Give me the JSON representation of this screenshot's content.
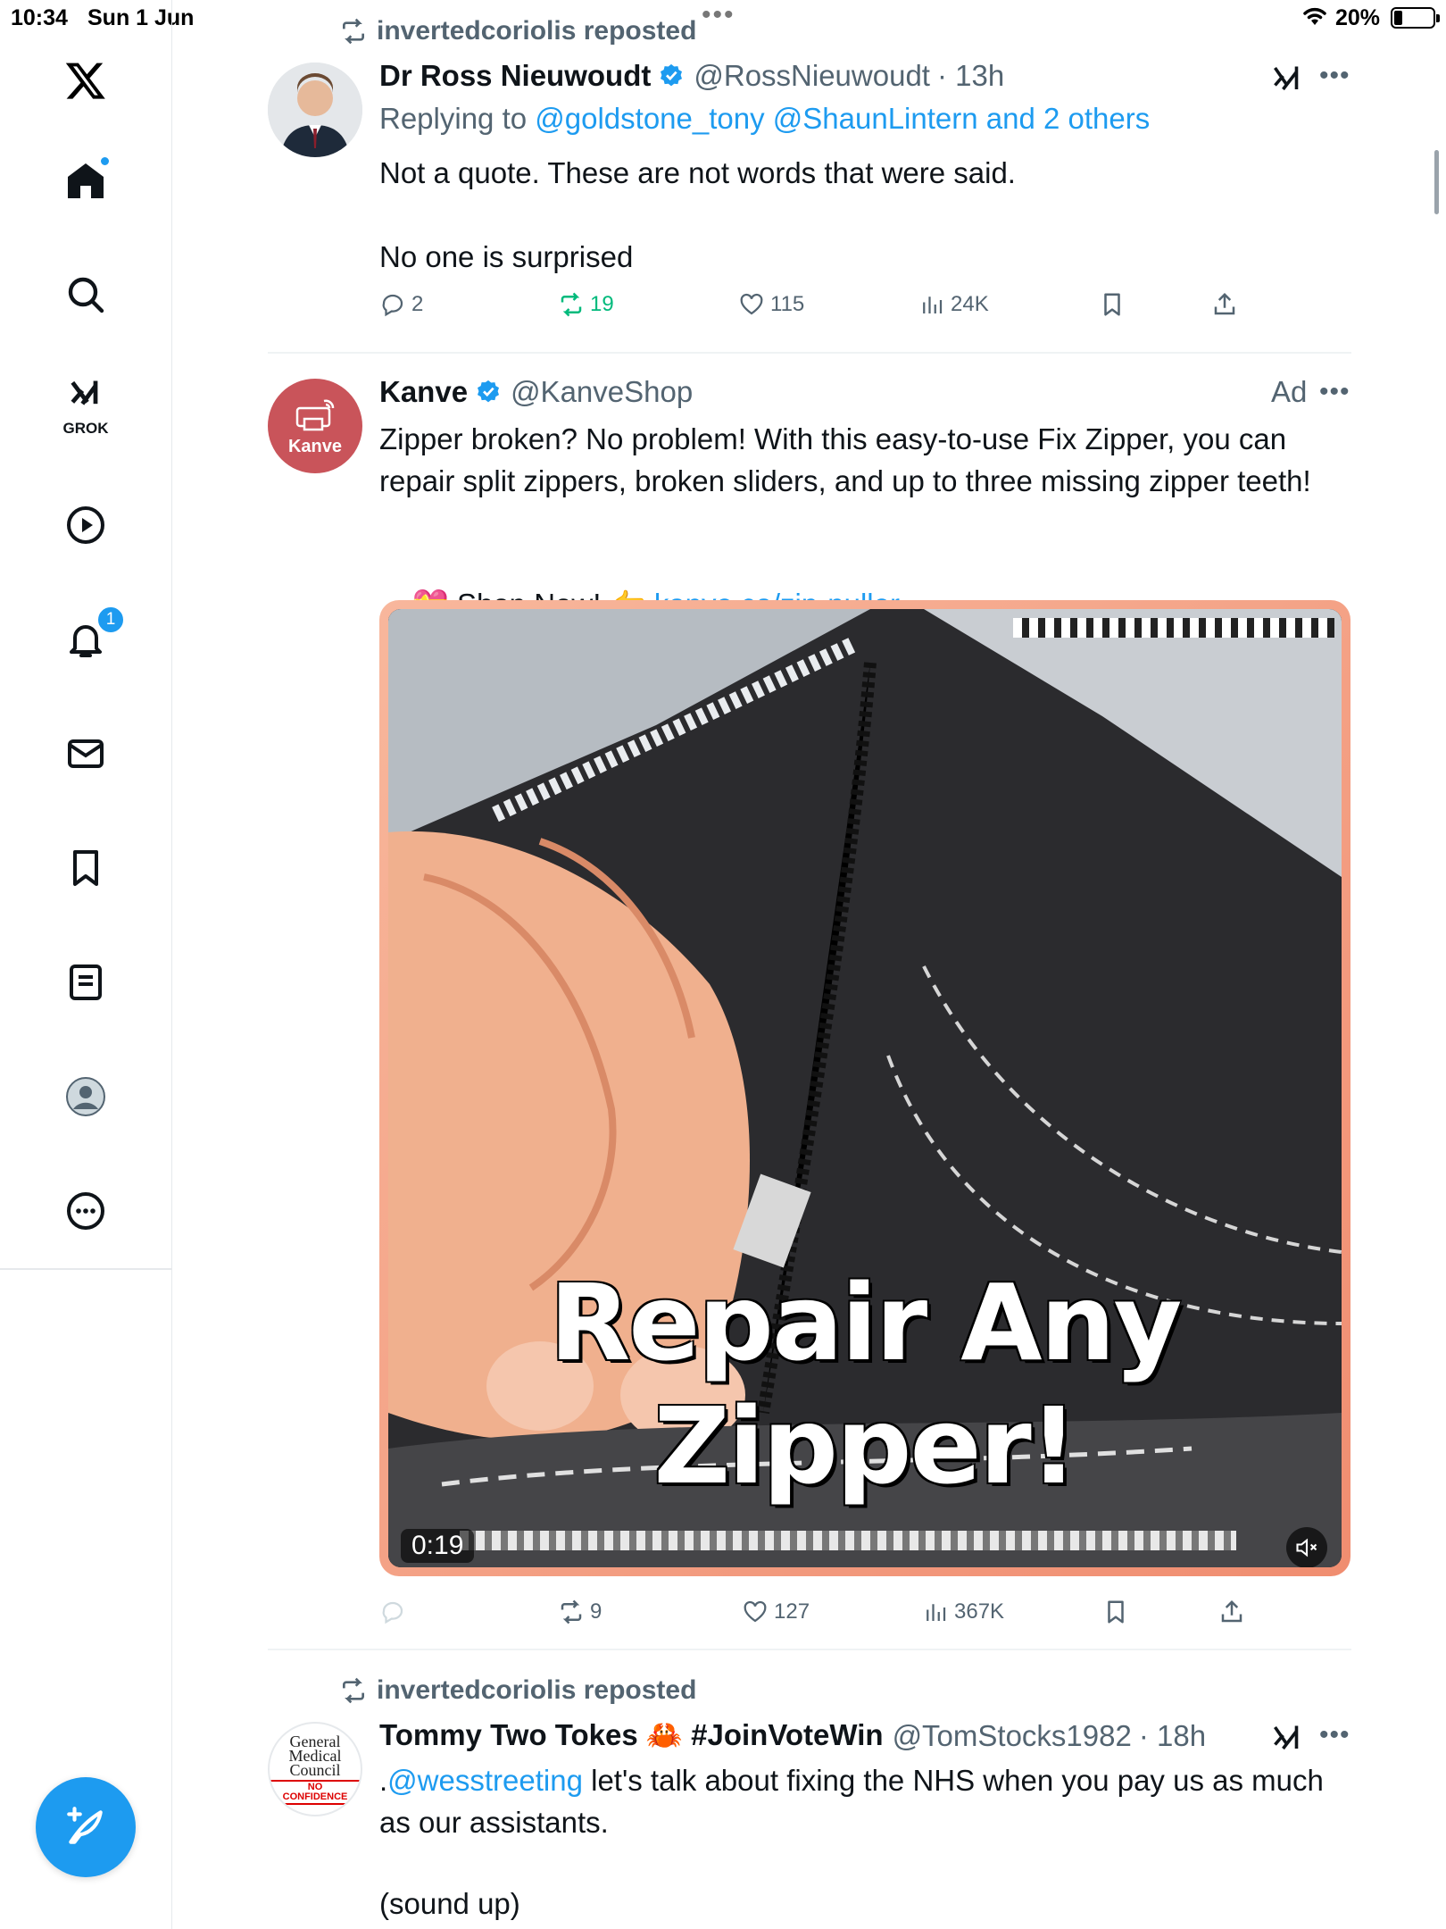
{
  "status_bar": {
    "time": "10:34",
    "date": "Sun 1 Jun",
    "battery": "20%"
  },
  "sidebar": {
    "grok_label": "GROK",
    "notifications_badge": "1"
  },
  "tweet1": {
    "repost_by": "invertedcoriolis reposted",
    "name": "Dr Ross Nieuwoudt",
    "handle": "@RossNieuwoudt",
    "time": "· 13h",
    "replying_prefix": "Replying to ",
    "replying_links": "@goldstone_tony @ShaunLintern and 2 others",
    "text": "Not a quote. These are not words that were said.\n\nNo one is surprised",
    "replies": "2",
    "reposts": "19",
    "likes": "115",
    "views": "24K"
  },
  "tweet2": {
    "name": "Kanve",
    "handle": "@KanveShop",
    "ad_label": "Ad",
    "avatar_label": "Kanve",
    "text": "Zipper broken? No problem! With this easy-to-use Fix Zipper, you can repair split zippers, broken sliders, and up to three missing zipper teeth!",
    "shop_emoji": "💝",
    "shop_text": " Shop Now! ",
    "point_emoji": "👉",
    "shop_link": "kanve.co/zip-puller",
    "video_caption": "Repair Any Zipper!",
    "video_duration": "0:19",
    "replies": "",
    "reposts": "9",
    "likes": "127",
    "views": "367K"
  },
  "tweet3": {
    "repost_by": "invertedcoriolis reposted",
    "name": "Tommy Two Tokes 🦀 #JoinVoteWin",
    "handle": "@TomStocks1982",
    "time": "· 18h",
    "avatar_lines": [
      "General",
      "Medical",
      "Council"
    ],
    "avatar_stamp": "NO CONFIDENCE",
    "text_prefix": ".",
    "mention": "@wesstreeting",
    "text_rest": " let's talk about fixing the NHS when you pay us as much as our assistants.",
    "text_tail": "(sound up)"
  },
  "colors": {
    "accent": "#1d9bf0",
    "secondary_text": "#536471",
    "repost_green": "#00ba7c"
  }
}
